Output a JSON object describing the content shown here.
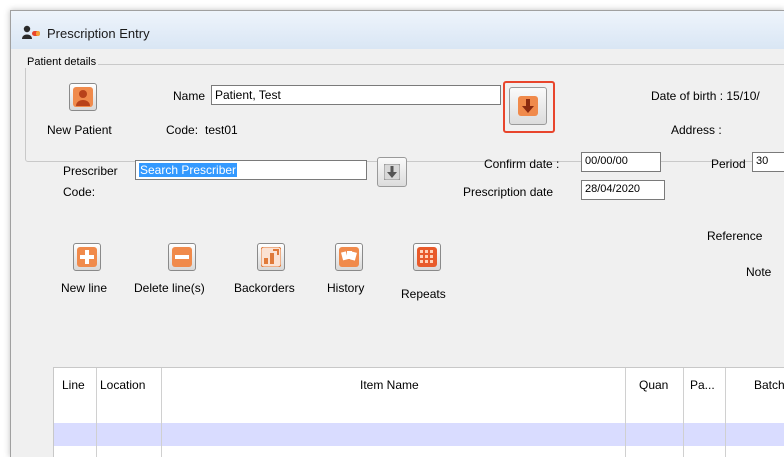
{
  "window": {
    "title": "Prescription Entry"
  },
  "patient": {
    "group_label": "Patient details",
    "new_patient_label": "New Patient",
    "name_label": "Name",
    "name_value": "Patient, Test",
    "code_label": "Code:",
    "code_value": "test01",
    "dob_label": "Date of birth : 15/10/",
    "address_label": "Address :"
  },
  "prescriber": {
    "label": "Prescriber",
    "value": "Search Prescriber",
    "code_label": "Code:"
  },
  "dates": {
    "confirm_label": "Confirm date :",
    "confirm_value": "00/00/00",
    "prescription_label": "Prescription date",
    "prescription_value": "28/04/2020",
    "period_label": "Period",
    "period_value": "30"
  },
  "side": {
    "reference_label": "Reference",
    "note_label": "Note"
  },
  "toolbar": {
    "new_line": "New line",
    "delete_lines": "Delete line(s)",
    "backorders": "Backorders",
    "history": "History",
    "repeats": "Repeats"
  },
  "grid": {
    "columns": [
      "Line",
      "Location",
      "Item Name",
      "Quan",
      "Pa...",
      "Batch"
    ]
  },
  "colors": {
    "accent_orange": "#e8452c",
    "selection_blue": "#3399ff",
    "row_highlight": "#d9dcff"
  }
}
